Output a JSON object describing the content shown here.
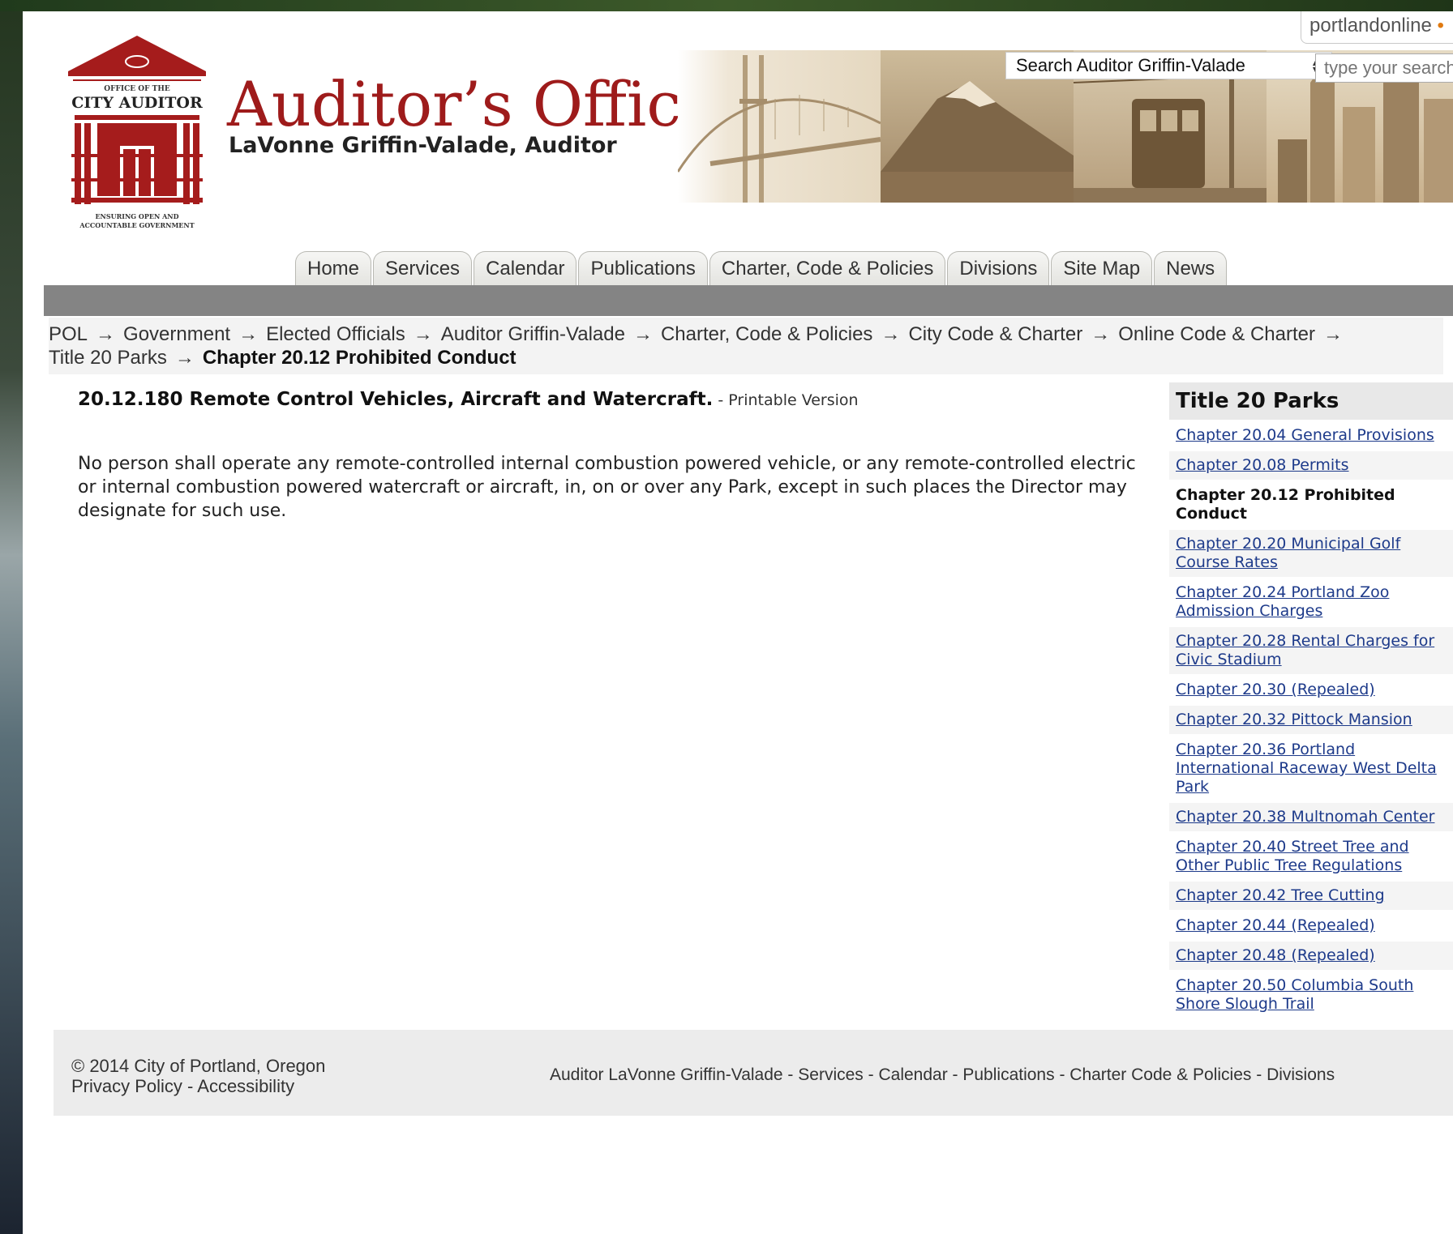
{
  "header": {
    "logo_top_text": "OFFICE OF THE",
    "logo_main_text": "CITY AUDITOR",
    "logo_bottom_text_1": "ENSURING OPEN AND",
    "logo_bottom_text_2": "ACCOUNTABLE GOVERNMENT",
    "title": "Auditor’s Office",
    "subtitle": "LaVonne Griffin-Valade, Auditor",
    "portland_link": "portlandonline",
    "search_scope": "Search Auditor Griffin-Valade",
    "search_placeholder": "type your search"
  },
  "nav": {
    "tabs": [
      "Home",
      "Services",
      "Calendar",
      "Publications",
      "Charter, Code & Policies",
      "Divisions",
      "Site Map",
      "News"
    ]
  },
  "breadcrumb": {
    "items": [
      "POL",
      "Government",
      "Elected Officials",
      "Auditor Griffin-Valade",
      "Charter, Code & Policies",
      "City Code & Charter",
      "Online Code & Charter",
      "Title 20 Parks"
    ],
    "separator": "→",
    "current": "Chapter 20.12 Prohibited Conduct"
  },
  "main": {
    "section_title": "20.12.180 Remote Control Vehicles, Aircraft and Watercraft.",
    "printable_prefix": " - ",
    "printable_label": "Printable Version",
    "body": "No person shall operate any remote-controlled internal combustion powered vehicle, or any remote-controlled electric or internal combustion powered watercraft or aircraft, in, on or over any Park, except in such places the Director may designate for such use."
  },
  "sidebar": {
    "title": "Title 20 Parks",
    "items": [
      {
        "label": "Chapter 20.04 General Provisions",
        "active": false
      },
      {
        "label": "Chapter 20.08 Permits",
        "active": false
      },
      {
        "label": "Chapter 20.12 Prohibited Conduct",
        "active": true
      },
      {
        "label": "Chapter 20.20 Municipal Golf Course Rates",
        "active": false
      },
      {
        "label": "Chapter 20.24 Portland Zoo Admission Charges",
        "active": false
      },
      {
        "label": "Chapter 20.28 Rental Charges for Civic Stadium",
        "active": false
      },
      {
        "label": "Chapter 20.30 (Repealed)",
        "active": false
      },
      {
        "label": "Chapter 20.32 Pittock Mansion",
        "active": false
      },
      {
        "label": "Chapter 20.36 Portland International Raceway West Delta Park",
        "active": false
      },
      {
        "label": "Chapter 20.38 Multnomah Center",
        "active": false
      },
      {
        "label": "Chapter 20.40 Street Tree and Other Public Tree Regulations",
        "active": false
      },
      {
        "label": "Chapter 20.42 Tree Cutting",
        "active": false
      },
      {
        "label": "Chapter 20.44 (Repealed)",
        "active": false
      },
      {
        "label": "Chapter 20.48 (Repealed)",
        "active": false
      },
      {
        "label": "Chapter 20.50 Columbia South Shore Slough Trail",
        "active": false
      }
    ]
  },
  "footer": {
    "copyright": "© 2014 City of Portland, Oregon",
    "privacy": "Privacy Policy",
    "accessibility": "Accessibility",
    "links": [
      "Auditor LaVonne Griffin-Valade",
      "Services",
      "Calendar",
      "Publications",
      "Charter Code & Policies",
      "Divisions"
    ],
    "link_separator": " - "
  },
  "colors": {
    "brand_red": "#9e1b1b",
    "nav_bar": "#848484",
    "link_blue": "#1d3a8a"
  }
}
